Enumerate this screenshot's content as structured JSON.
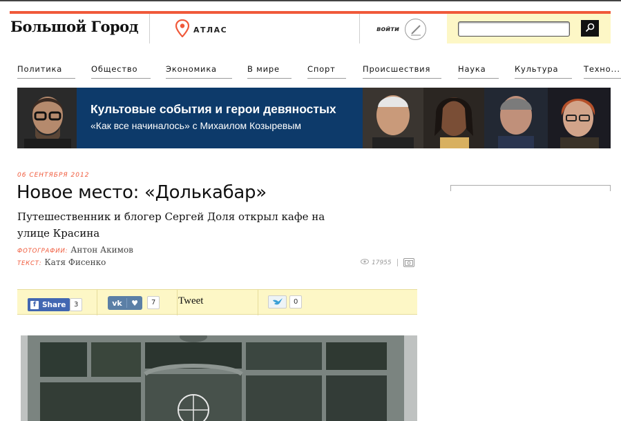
{
  "header": {
    "logo": "Большой Город",
    "atlas_label": "АТЛАС",
    "write_label": "войти",
    "search": {
      "value": "",
      "placeholder": ""
    }
  },
  "nav": {
    "items": [
      "Политика",
      "Общество",
      "Экономика",
      "В мире",
      "Спорт",
      "Происшествия",
      "Наука",
      "Культура",
      "Техно..."
    ]
  },
  "banner": {
    "title": "Культовые события и герои девяностых",
    "subtitle": "«Как все начиналось» с Михаилом Козыревым"
  },
  "article": {
    "date": "06 СЕНТЯБРЯ 2012",
    "title": "Новое место: «Долькабар»",
    "subtitle": "Путешественник и блогер Сергей Доля открыл кафе на улице Красина",
    "photo_role": "ФОТОГРАФИИ:",
    "photo_author": "Антон Акимов",
    "text_role": "ТЕКСТ:",
    "text_author": "Катя Фисенко",
    "views": "17955"
  },
  "share": {
    "facebook_label": "Share",
    "facebook_count": "3",
    "vk_label": "vk",
    "vk_count": "7",
    "tweet_label": "Tweet",
    "bird_count": "0"
  },
  "colors": {
    "accent": "#f0593a",
    "banner_bg": "#0d3a6a",
    "share_bar_bg": "#fdf7c6",
    "facebook": "#4267b2",
    "vk": "#5b7fa6"
  }
}
